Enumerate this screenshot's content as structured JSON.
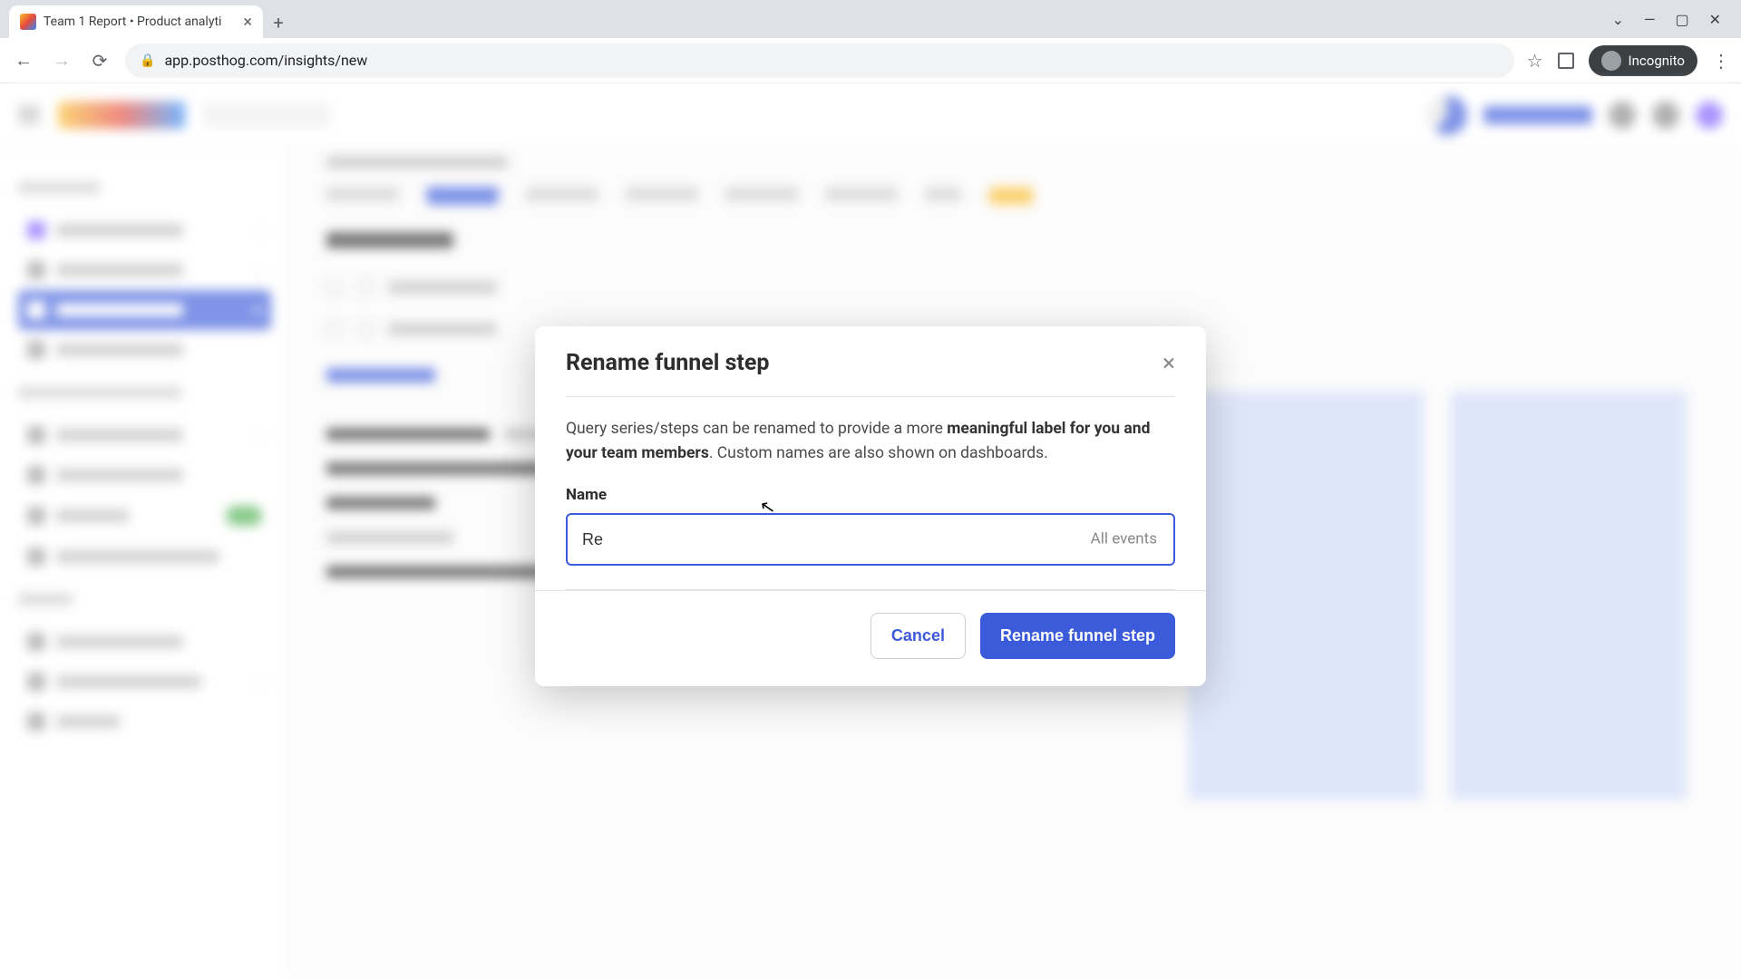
{
  "browser": {
    "tab_title": "Team 1 Report • Product analyti",
    "url": "app.posthog.com/insights/new",
    "incognito_label": "Incognito"
  },
  "modal": {
    "title": "Rename funnel step",
    "desc_pre": "Query series/steps can be renamed to provide a more ",
    "desc_bold": "meaningful label for you and your team members",
    "desc_post": ". Custom names are also shown on dashboards.",
    "field_label": "Name",
    "input_value": "Re",
    "input_placeholder": "All events",
    "cancel_label": "Cancel",
    "submit_label": "Rename funnel step"
  }
}
